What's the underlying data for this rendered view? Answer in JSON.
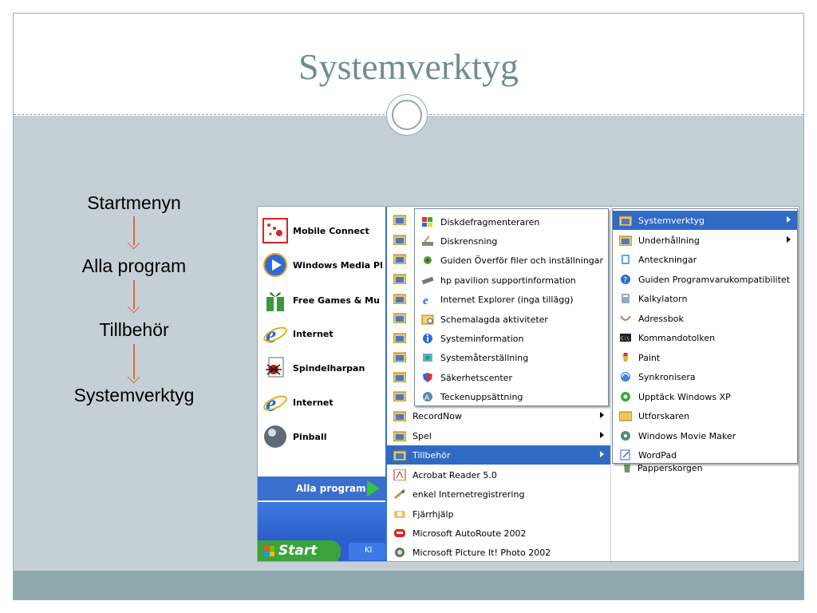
{
  "slide": {
    "title": "Systemverktyg",
    "steps": [
      "Startmenyn",
      "Alla program",
      "Tillbehör",
      "Systemverktyg"
    ]
  },
  "startmenu": {
    "pinned": [
      {
        "label": "Mobile Connect",
        "icon": "mobile-connect-icon"
      },
      {
        "label": "Windows Media Pl",
        "icon": "media-player-icon"
      },
      {
        "label": "Free Games & Mu",
        "icon": "games-gift-icon"
      },
      {
        "label": "Internet",
        "icon": "ie-icon"
      },
      {
        "label": "Spindelharpan",
        "icon": "spider-solitaire-icon"
      },
      {
        "label": "Internet",
        "icon": "ie-icon"
      },
      {
        "label": "Pinball",
        "icon": "pinball-icon"
      }
    ],
    "all_programs_label": "Alla program",
    "start_label": "Start",
    "task_label": "Kl"
  },
  "programs": [
    {
      "label": "RecordNow",
      "submenu": true
    },
    {
      "label": "Spel",
      "submenu": true
    },
    {
      "label": "Tillbehör",
      "submenu": true,
      "selected": true
    },
    {
      "label": "Acrobat Reader 5.0",
      "submenu": false
    },
    {
      "label": "enkel Internetregistrering",
      "submenu": false
    },
    {
      "label": "Fjärrhjälp",
      "submenu": false
    },
    {
      "label": "Microsoft AutoRoute 2002",
      "submenu": false
    },
    {
      "label": "Microsoft Picture It! Photo 2002",
      "submenu": false
    }
  ],
  "systemverktyg_menu": [
    "Diskdefragmenteraren",
    "Diskrensning",
    "Guiden Överför filer och inställningar",
    "hp pavilion supportinformation",
    "Internet Explorer (inga tillägg)",
    "Schemalagda aktiviteter",
    "Systeminformation",
    "Systemåterställning",
    "Säkerhetscenter",
    "Teckenuppsättning"
  ],
  "tillbehor_menu": [
    {
      "label": "Systemverktyg",
      "submenu": true,
      "selected": true
    },
    {
      "label": "Underhållning",
      "submenu": true
    },
    {
      "label": "Anteckningar"
    },
    {
      "label": "Guiden Programvarukompatibilitet"
    },
    {
      "label": "Kalkylatorn"
    },
    {
      "label": "Adressbok"
    },
    {
      "label": "Kommandotolken"
    },
    {
      "label": "Paint"
    },
    {
      "label": "Synkronisera"
    },
    {
      "label": "Upptäck Windows XP"
    },
    {
      "label": "Utforskaren"
    },
    {
      "label": "Windows Movie Maker"
    },
    {
      "label": "WordPad"
    }
  ],
  "papperskorgen_label": "Papperskorgen",
  "colors": {
    "accent_blue": "#316ac5",
    "arrow_orange": "#e0653a",
    "title_teal": "#6d8d94"
  }
}
